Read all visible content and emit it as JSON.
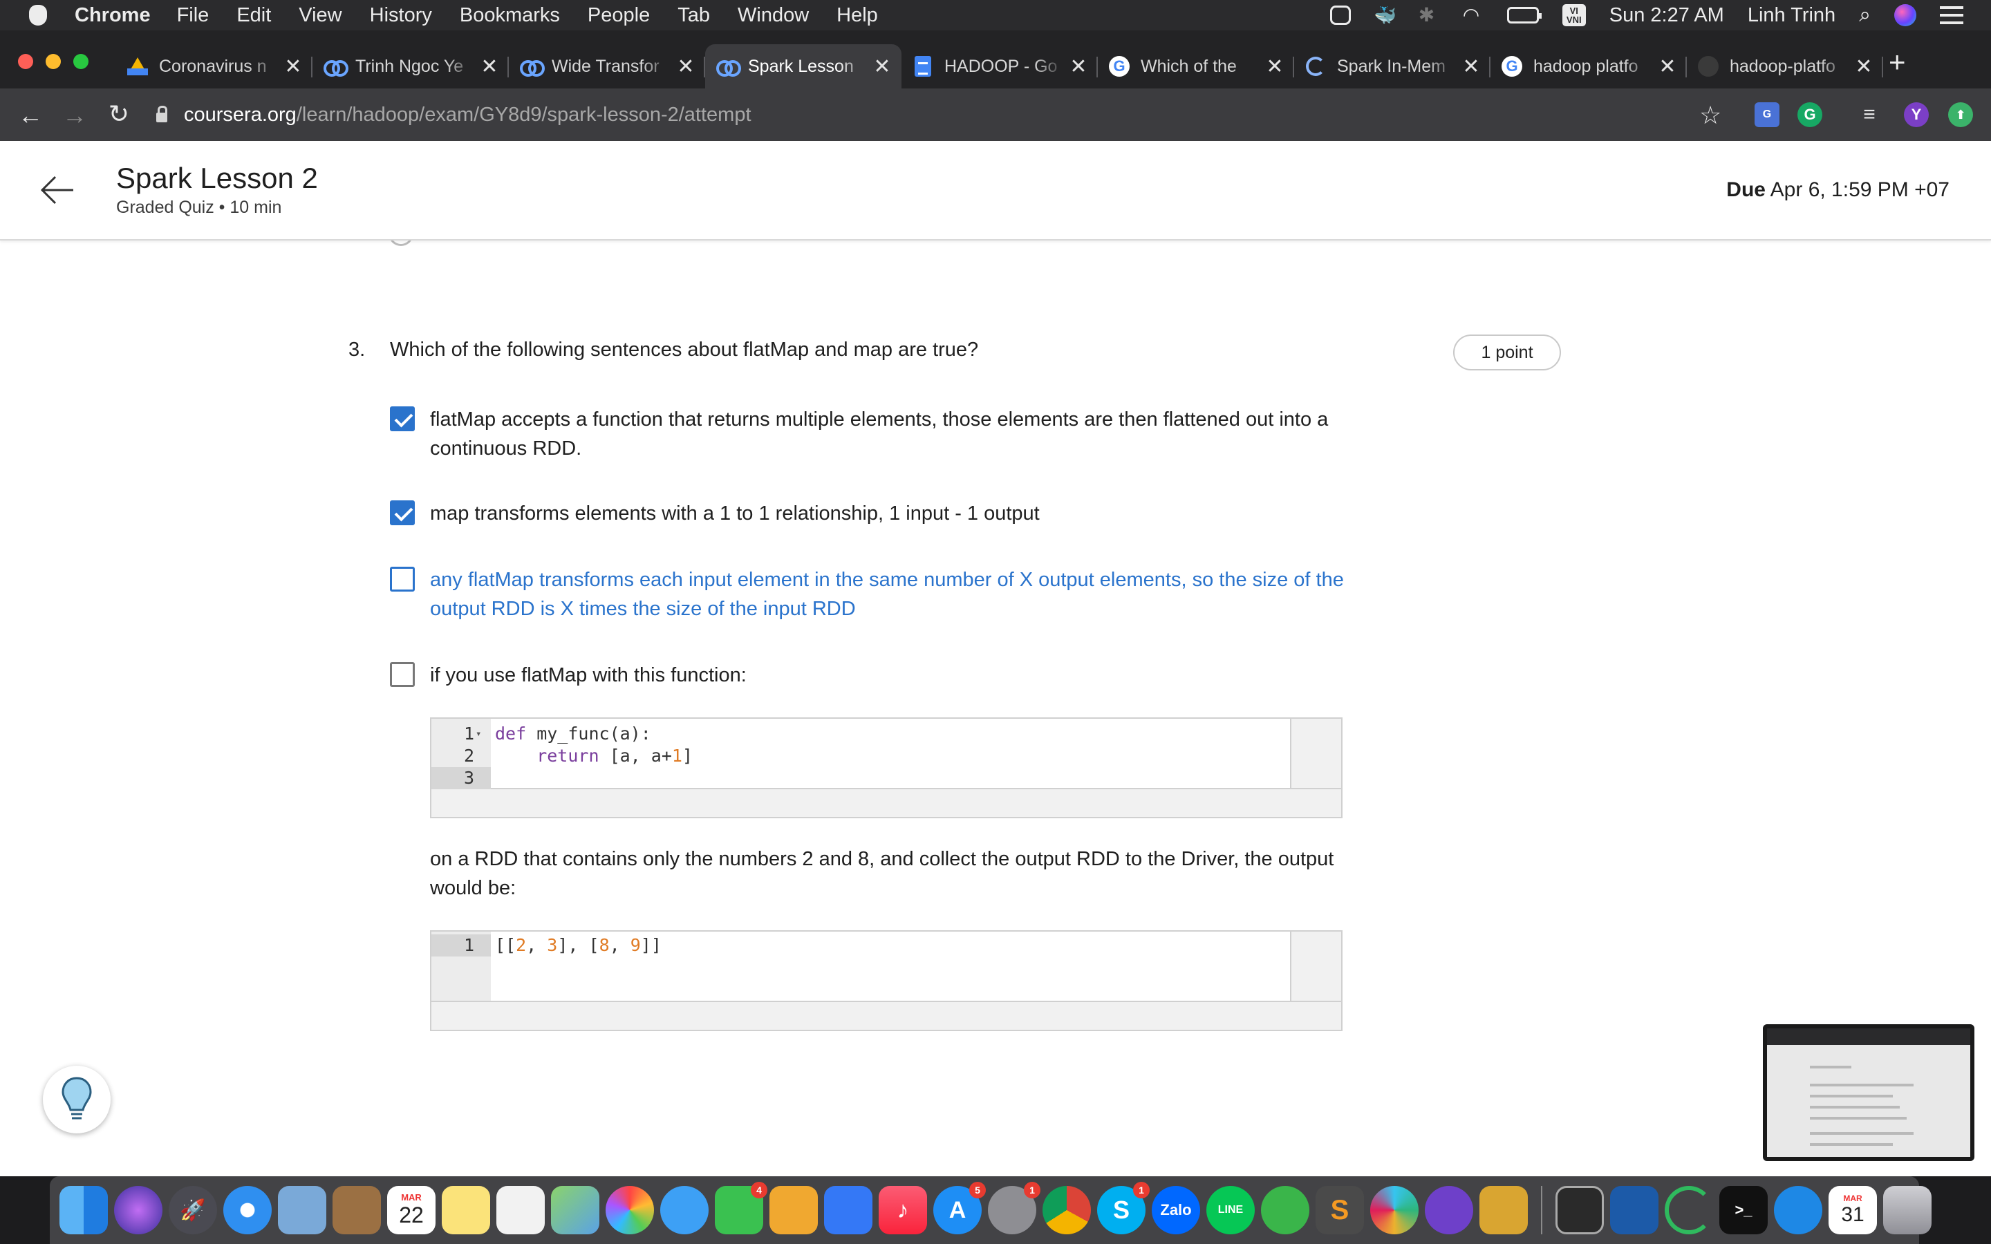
{
  "menubar": {
    "app_name": "Chrome",
    "menus": [
      "File",
      "Edit",
      "View",
      "History",
      "Bookmarks",
      "People",
      "Tab",
      "Window",
      "Help"
    ],
    "input_source": "VI\nVNI",
    "clock": "Sun 2:27 AM",
    "user": "Linh Trinh"
  },
  "tabs": [
    {
      "title": "Coronavirus n",
      "icon": "google-drive-icon"
    },
    {
      "title": "Trinh Ngoc Ye",
      "icon": "coursera-icon"
    },
    {
      "title": "Wide Transfor",
      "icon": "coursera-icon"
    },
    {
      "title": "Spark Lesson",
      "icon": "coursera-icon",
      "active": true
    },
    {
      "title": "HADOOP - Go",
      "icon": "google-docs-icon"
    },
    {
      "title": "Which of the",
      "icon": "google-icon"
    },
    {
      "title": "Spark In-Mem",
      "icon": "spark-icon"
    },
    {
      "title": "hadoop platfo",
      "icon": "google-icon"
    },
    {
      "title": "hadoop-platfo",
      "icon": "github-icon"
    }
  ],
  "toolbar": {
    "url_host": "coursera.org",
    "url_path": "/learn/hadoop/exam/GY8d9/spark-lesson-2/attempt",
    "profile_initial": "Y"
  },
  "header": {
    "title": "Spark Lesson 2",
    "meta": "Graded Quiz • 10 min",
    "due_label": "Due",
    "due_value": "Apr 6, 1:59 PM +07"
  },
  "question": {
    "number": "3.",
    "text": "Which of the following sentences about flatMap and map are true?",
    "points": "1 point",
    "options": [
      {
        "text": "flatMap accepts a function that returns multiple elements, those elements are then flattened out into a continuous RDD.",
        "checked": true
      },
      {
        "text": "map transforms elements with a 1 to 1 relationship, 1 input - 1 output",
        "checked": true
      },
      {
        "text": "any flatMap transforms each input element in the same number of X output elements, so the size of the output RDD is X times the size of the input RDD",
        "checked": false
      },
      {
        "text": "if you use flatMap with this function:",
        "checked": false
      }
    ],
    "code_lines": [
      {
        "n": "1",
        "kw": "def",
        "rest": " my_func(a):"
      },
      {
        "n": "2",
        "kw": "    return",
        "rest": " [a, a+",
        "num": "1",
        "tail": "]"
      },
      {
        "n": "3",
        "kw": "",
        "rest": ""
      }
    ],
    "followup": "on a RDD that contains only the numbers 2 and 8, and collect the output RDD to the Driver, the output would be:",
    "output_line": {
      "n": "1",
      "a": "2",
      "b": "3",
      "c": "8",
      "d": "9"
    }
  },
  "dock": {
    "calendar_month": "MAR",
    "calendar_day": "22",
    "calendar2_month": "MAR",
    "calendar2_day": "31",
    "facetime_badge": "4",
    "appstore_badge": "5",
    "prefs_badge": "1",
    "skype_badge": "1",
    "zalo_label": "Zalo",
    "line_label": "LINE"
  }
}
